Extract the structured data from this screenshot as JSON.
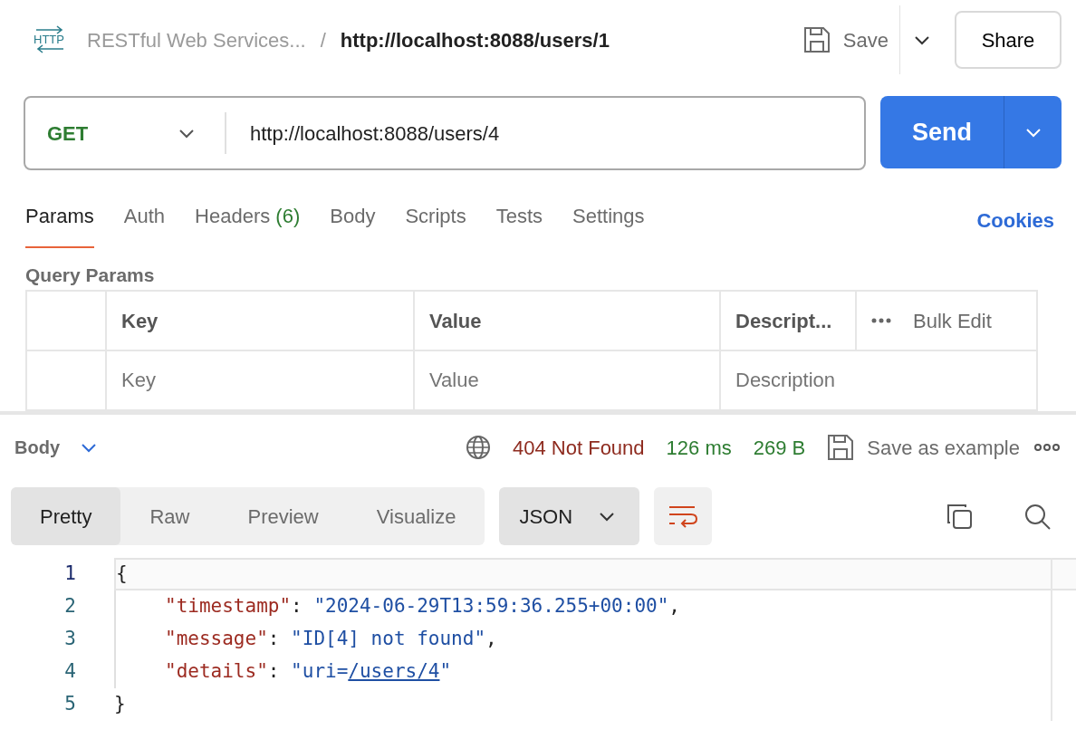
{
  "header": {
    "icon_text": "HTTP",
    "collection": "RESTful Web Services...",
    "separator": "/",
    "request_name": "http://localhost:8088/users/1",
    "save": "Save",
    "share": "Share"
  },
  "request": {
    "method": "GET",
    "url": "http://localhost:8088/users/4",
    "send": "Send"
  },
  "tabs": [
    {
      "label": "Params",
      "selected": true
    },
    {
      "label": "Auth",
      "selected": false
    },
    {
      "label": "Headers",
      "count": "(6)",
      "selected": false
    },
    {
      "label": "Body",
      "selected": false
    },
    {
      "label": "Scripts",
      "selected": false
    },
    {
      "label": "Tests",
      "selected": false
    },
    {
      "label": "Settings",
      "selected": false
    }
  ],
  "cookies": "Cookies",
  "query_params": {
    "title": "Query Params",
    "columns": [
      "Key",
      "Value",
      "Descript..."
    ],
    "bulk_edit": "Bulk Edit",
    "placeholders": [
      "Key",
      "Value",
      "Description"
    ]
  },
  "response": {
    "section": "Body",
    "status": "404 Not Found",
    "time": "126 ms",
    "size": "269 B",
    "save_example": "Save as example",
    "views": [
      {
        "label": "Pretty",
        "selected": true
      },
      {
        "label": "Raw",
        "selected": false
      },
      {
        "label": "Preview",
        "selected": false
      },
      {
        "label": "Visualize",
        "selected": false
      }
    ],
    "format": "JSON",
    "lines": [
      {
        "number": "1",
        "active": true,
        "indented": false,
        "tokens": [
          {
            "kind": "punct",
            "text": "{"
          }
        ]
      },
      {
        "number": "2",
        "active": false,
        "indented": true,
        "tokens": [
          {
            "kind": "key",
            "text": "\"timestamp\""
          },
          {
            "kind": "punct",
            "text": ": "
          },
          {
            "kind": "string",
            "text": "\"2024-06-29T13:59:36.255+00:00\""
          },
          {
            "kind": "punct",
            "text": ","
          }
        ]
      },
      {
        "number": "3",
        "active": false,
        "indented": true,
        "tokens": [
          {
            "kind": "key",
            "text": "\"message\""
          },
          {
            "kind": "punct",
            "text": ": "
          },
          {
            "kind": "string",
            "text": "\"ID[4] not found\""
          },
          {
            "kind": "punct",
            "text": ","
          }
        ]
      },
      {
        "number": "4",
        "active": false,
        "indented": true,
        "tokens": [
          {
            "kind": "key",
            "text": "\"details\""
          },
          {
            "kind": "punct",
            "text": ": "
          },
          {
            "kind": "string",
            "text": "\"uri="
          },
          {
            "kind": "link",
            "text": "/users/4"
          },
          {
            "kind": "string",
            "text": "\""
          }
        ]
      },
      {
        "number": "5",
        "active": false,
        "indented": false,
        "tokens": [
          {
            "kind": "punct",
            "text": "}"
          }
        ]
      }
    ]
  }
}
